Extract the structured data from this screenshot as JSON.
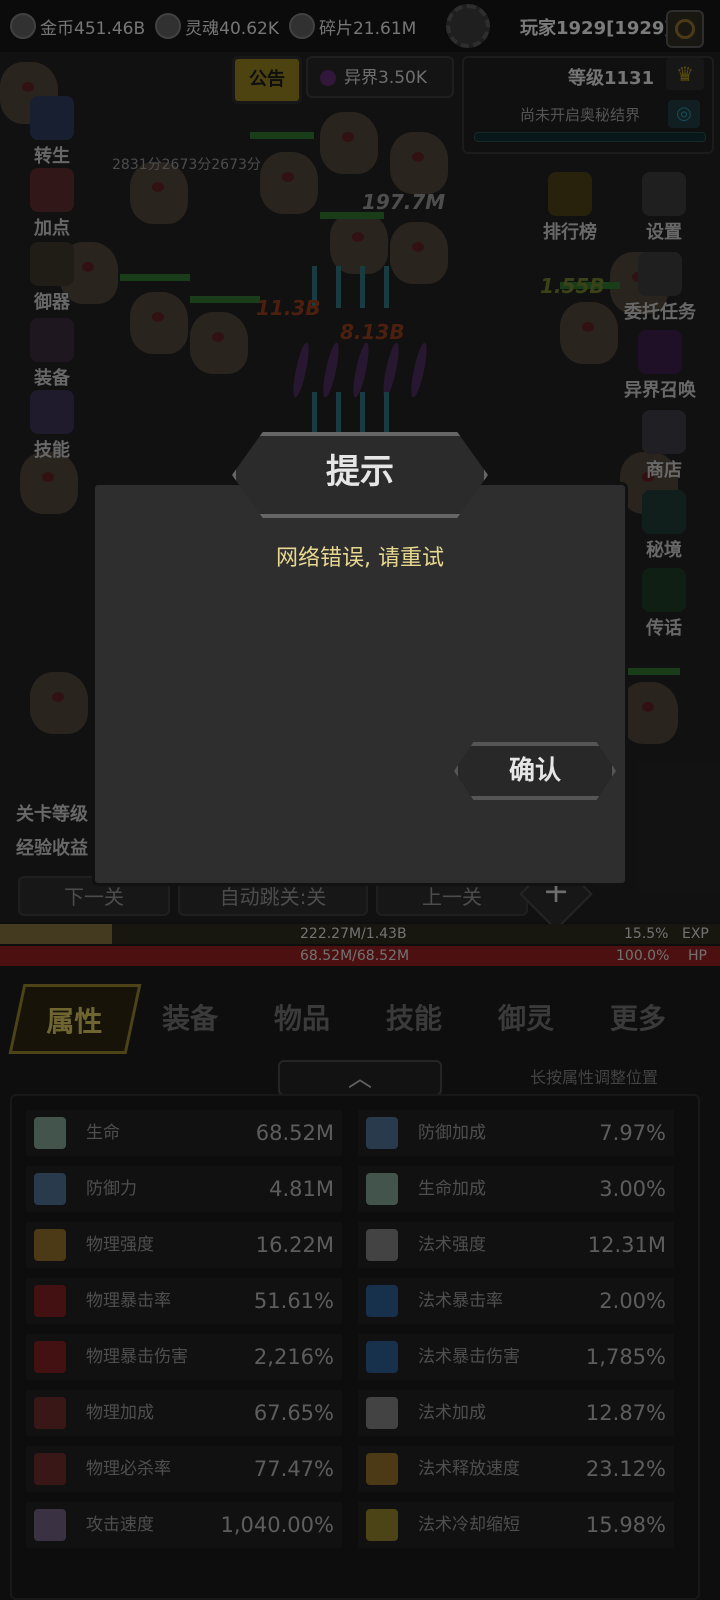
{
  "top_bar": {
    "resources": [
      {
        "icon": "gold-coin-icon",
        "text": "金币451.46B"
      },
      {
        "icon": "soul-icon",
        "text": "灵魂40.62K"
      },
      {
        "icon": "fragment-icon",
        "text": "碎片21.61M"
      }
    ],
    "player_name": "玩家1929[1929]"
  },
  "header": {
    "notice_label": "公告",
    "realm_label": "异界3.50K",
    "level_label": "等级1131",
    "secret_realm_label": "尚未开启奥秘结界",
    "score_text": "2831分2673分2673分"
  },
  "left_menu": [
    "转生",
    "加点",
    "御器",
    "装备",
    "技能"
  ],
  "right_menu": [
    "排行榜",
    "设置",
    "委托任务",
    "异界召唤",
    "商店",
    "秘境",
    "传话"
  ],
  "field": {
    "damage_numbers": [
      "197.7M",
      "11.3B",
      "1.55B",
      "8.13B"
    ]
  },
  "stage": {
    "line1": "关卡等级",
    "line2": "经验收益",
    "next_button": "下一关",
    "auto_button": "自动跳关:关",
    "prev_button": "上一关"
  },
  "bars": {
    "exp_text": "222.27M/1.43B",
    "exp_percent_text": "15.5%",
    "exp_fraction": 0.155,
    "exp_label": "EXP",
    "hp_text": "68.52M/68.52M",
    "hp_percent_text": "100.0%",
    "hp_fraction": 1.0,
    "hp_label": "HP"
  },
  "tabs": [
    "属性",
    "装备",
    "物品",
    "技能",
    "御灵",
    "更多"
  ],
  "hint": "长按属性调整位置",
  "stats": [
    {
      "icon": "cross-life-icon",
      "name": "生命",
      "value": "68.52M",
      "color": "#7a9a8a"
    },
    {
      "icon": "shield-icon",
      "name": "防御加成",
      "value": "7.97%",
      "color": "#4a6a8a"
    },
    {
      "icon": "shield-icon",
      "name": "防御力",
      "value": "4.81M",
      "color": "#4a6a8a"
    },
    {
      "icon": "cross-life-icon",
      "name": "生命加成",
      "value": "3.00%",
      "color": "#7a9a8a"
    },
    {
      "icon": "blade-icon",
      "name": "物理强度",
      "value": "16.22M",
      "color": "#8a6a2a"
    },
    {
      "icon": "lightning-icon",
      "name": "法术强度",
      "value": "12.31M",
      "color": "#7a7a7a"
    },
    {
      "icon": "red-crit-icon",
      "name": "物理暴击率",
      "value": "51.61%",
      "color": "#7a2020"
    },
    {
      "icon": "blue-flame-icon",
      "name": "法术暴击率",
      "value": "2.00%",
      "color": "#2a5a8a"
    },
    {
      "icon": "red-crit-icon",
      "name": "物理暴击伤害",
      "value": "2,216%",
      "color": "#7a2020"
    },
    {
      "icon": "blue-flame-icon",
      "name": "法术暴击伤害",
      "value": "1,785%",
      "color": "#2a5a8a"
    },
    {
      "icon": "slash-icon",
      "name": "物理加成",
      "value": "67.65%",
      "color": "#6a2a2a"
    },
    {
      "icon": "lightning-icon",
      "name": "法术加成",
      "value": "12.87%",
      "color": "#7a7a7a"
    },
    {
      "icon": "slash-icon",
      "name": "物理必杀率",
      "value": "77.47%",
      "color": "#6a2a2a"
    },
    {
      "icon": "cast-speed-icon",
      "name": "法术释放速度",
      "value": "23.12%",
      "color": "#8a6a2a"
    },
    {
      "icon": "sword-icon",
      "name": "攻击速度",
      "value": "1,040.00%",
      "color": "#6a5a7a"
    },
    {
      "icon": "cooldown-icon",
      "name": "法术冷却缩短",
      "value": "15.98%",
      "color": "#8a7a2a"
    }
  ],
  "dialog": {
    "title": "提示",
    "message": "网络错误, 请重试",
    "confirm": "确认"
  }
}
